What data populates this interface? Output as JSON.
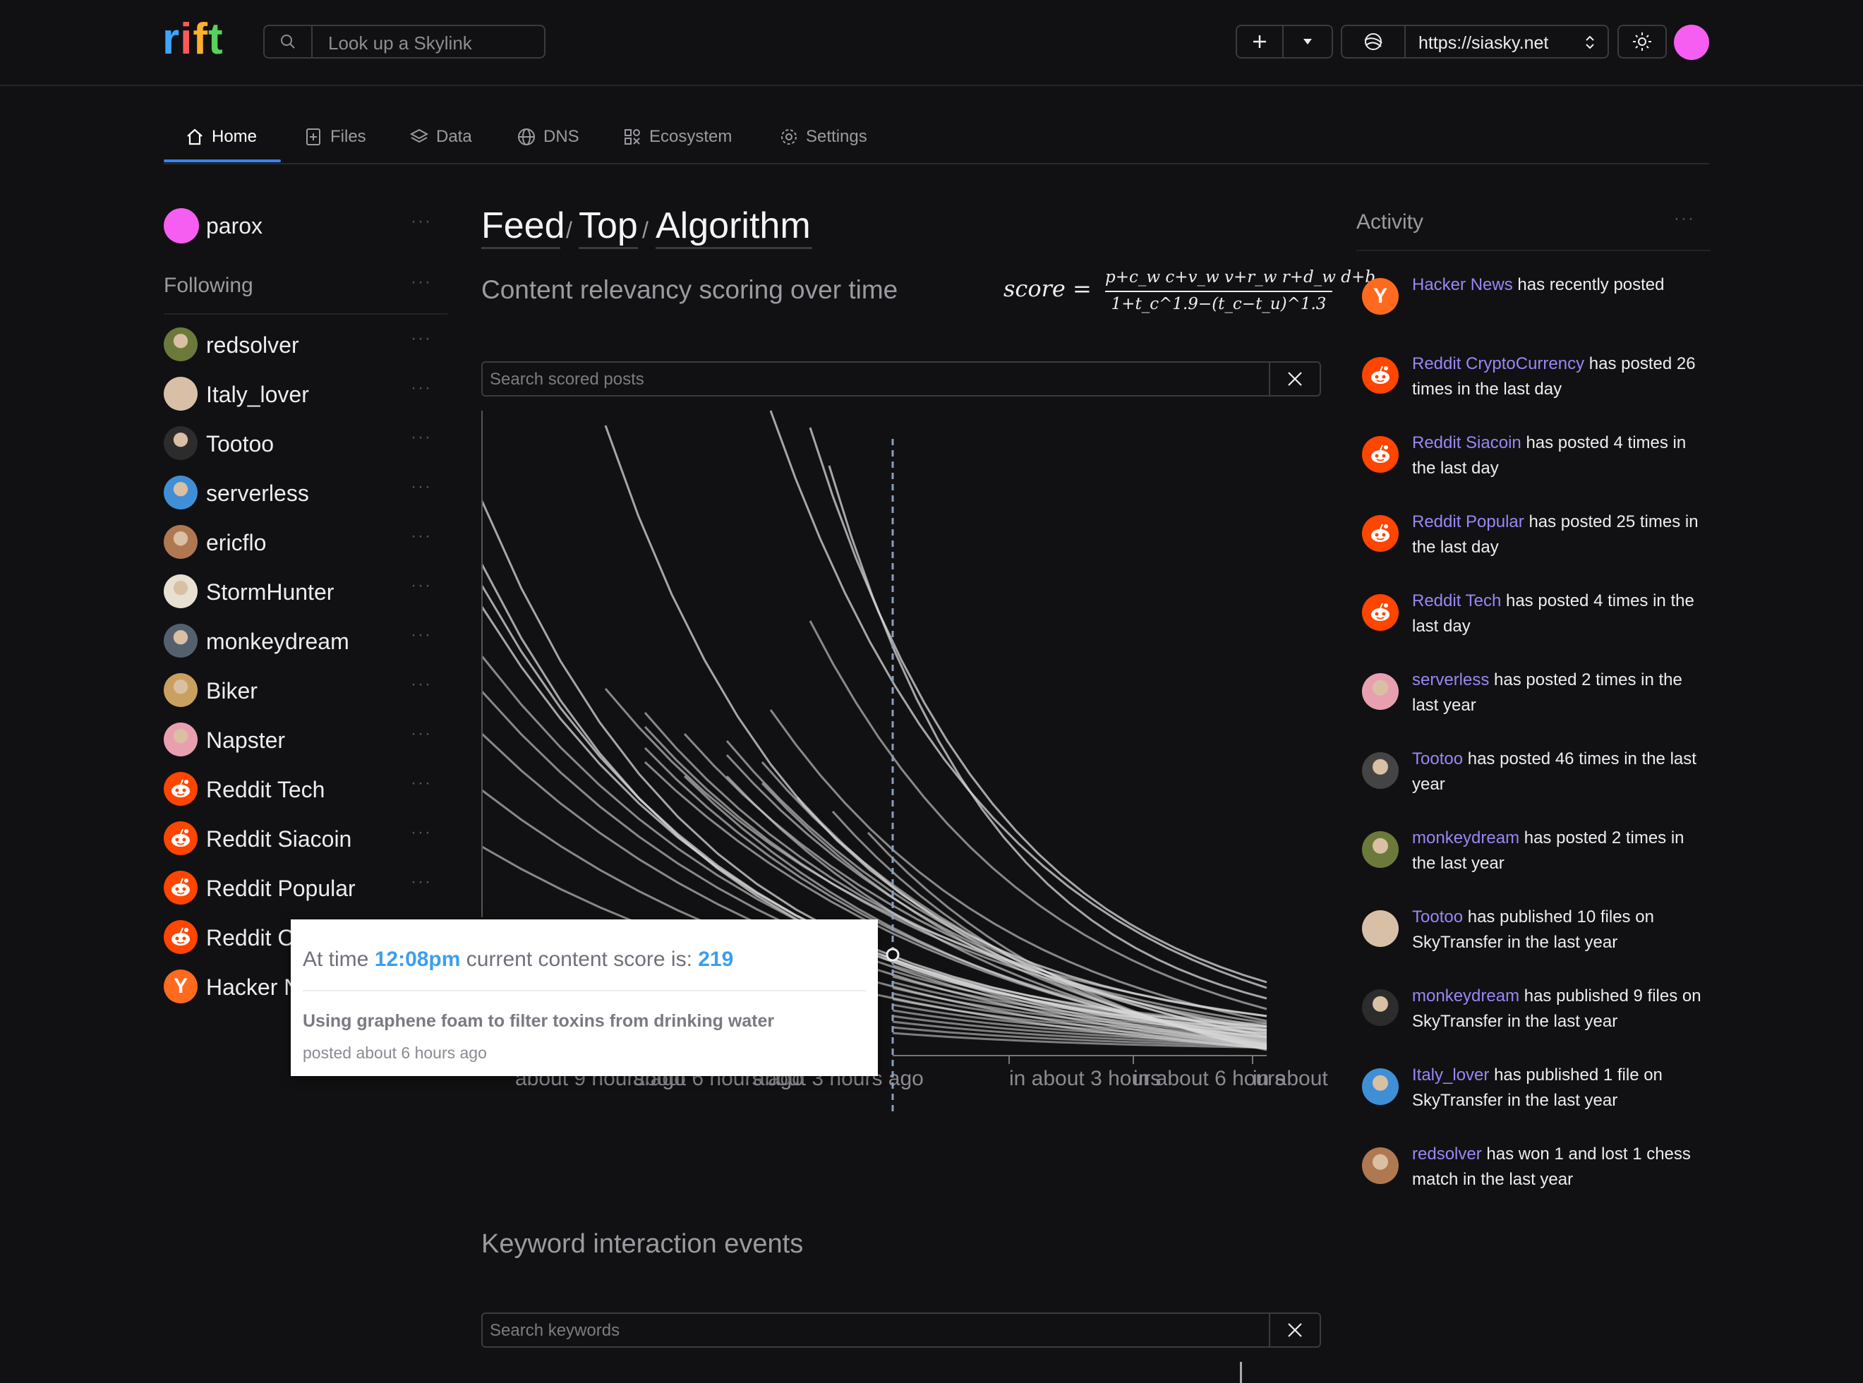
{
  "app": {
    "logo": "rift"
  },
  "topbar": {
    "search_placeholder": "Look up a Skylink",
    "portal_url": "https://siasky.net"
  },
  "nav": {
    "tabs": [
      {
        "label": "Home",
        "icon": "home-icon",
        "active": true
      },
      {
        "label": "Files",
        "icon": "file-plus-icon"
      },
      {
        "label": "Data",
        "icon": "layers-icon"
      },
      {
        "label": "DNS",
        "icon": "globe-icon"
      },
      {
        "label": "Ecosystem",
        "icon": "apps-icon"
      },
      {
        "label": "Settings",
        "icon": "gear-icon"
      }
    ]
  },
  "sidebar": {
    "me": "parox",
    "following_title": "Following",
    "following": [
      {
        "name": "redsolver",
        "avatar": "photo"
      },
      {
        "name": "Italy_lover",
        "avatar": "photo"
      },
      {
        "name": "Tootoo",
        "avatar": "photo"
      },
      {
        "name": "serverless",
        "avatar": "photo"
      },
      {
        "name": "ericflo",
        "avatar": "photo"
      },
      {
        "name": "StormHunter",
        "avatar": "photo"
      },
      {
        "name": "monkeydream",
        "avatar": "photo"
      },
      {
        "name": "Biker",
        "avatar": "photo"
      },
      {
        "name": "Napster",
        "avatar": "photo"
      },
      {
        "name": "Reddit Tech",
        "avatar": "reddit"
      },
      {
        "name": "Reddit Siacoin",
        "avatar": "reddit"
      },
      {
        "name": "Reddit Popular",
        "avatar": "reddit"
      },
      {
        "name": "Reddit C",
        "avatar": "reddit"
      },
      {
        "name": "Hacker N",
        "avatar": "hn"
      }
    ]
  },
  "main": {
    "breadcrumb": [
      "Feed",
      "Top",
      "Algorithm"
    ],
    "subtitle": "Content relevancy scoring over time",
    "formula": {
      "lhs": "score =",
      "numerator": "p+c_w c+v_w v+r_w r+d_w d+b",
      "denominator": "1+t_c^1.9−(t_c−t_u)^1.3"
    },
    "search_posts_placeholder": "Search scored posts",
    "keywords_title": "Keyword interaction events",
    "search_keywords_placeholder": "Search keywords"
  },
  "chart_data": {
    "type": "line",
    "x_tick_labels": [
      "about 9 hours ago",
      "about 6 hours ago",
      "about 3 hours ago",
      "in about 3 hours",
      "in about 6 hours",
      "in about"
    ],
    "note_series": "decaying content-score curves of scored posts"
  },
  "tooltip": {
    "prefix": "At time",
    "time": "12:08pm",
    "middle": "current content score is:",
    "score": "219",
    "post_title": "Using graphene foam to filter toxins from drinking water",
    "posted": "posted about 6 hours ago"
  },
  "activity": {
    "title": "Activity",
    "items": [
      {
        "who": "Hacker News",
        "text": "has recently posted",
        "avatar": "hn"
      },
      {
        "who": "Reddit CryptoCurrency",
        "text": "has posted 26 times in the last day",
        "avatar": "reddit"
      },
      {
        "who": "Reddit Siacoin",
        "text": "has posted 4 times in the last day",
        "avatar": "reddit"
      },
      {
        "who": "Reddit Popular",
        "text": "has posted 25 times in the last day",
        "avatar": "reddit"
      },
      {
        "who": "Reddit Tech",
        "text": "has posted 4 times in the last day",
        "avatar": "reddit"
      },
      {
        "who": "serverless",
        "text": "has posted 2 times in the last year",
        "avatar": "photo"
      },
      {
        "who": "Tootoo",
        "text": "has posted 46 times in the last year",
        "avatar": "photo"
      },
      {
        "who": "monkeydream",
        "text": "has posted 2 times in the last year",
        "avatar": "photo"
      },
      {
        "who": "Tootoo",
        "text": "has published 10 files on SkyTransfer in the last year",
        "avatar": "photo"
      },
      {
        "who": "monkeydream",
        "text": "has published 9 files on SkyTransfer in the last year",
        "avatar": "photo"
      },
      {
        "who": "Italy_lover",
        "text": "has published 1 file on SkyTransfer in the last year",
        "avatar": "photo"
      },
      {
        "who": "redsolver",
        "text": "has won 1 and lost 1 chess match in the last year",
        "avatar": "photo"
      }
    ]
  },
  "colors": {
    "background": "#111113",
    "accent_avatar": "#f55ef0",
    "link": "#9b86f5",
    "tab_underline": "#3b82f6",
    "tooltip_value": "#3b9ff0",
    "reddit": "#ff4500"
  }
}
